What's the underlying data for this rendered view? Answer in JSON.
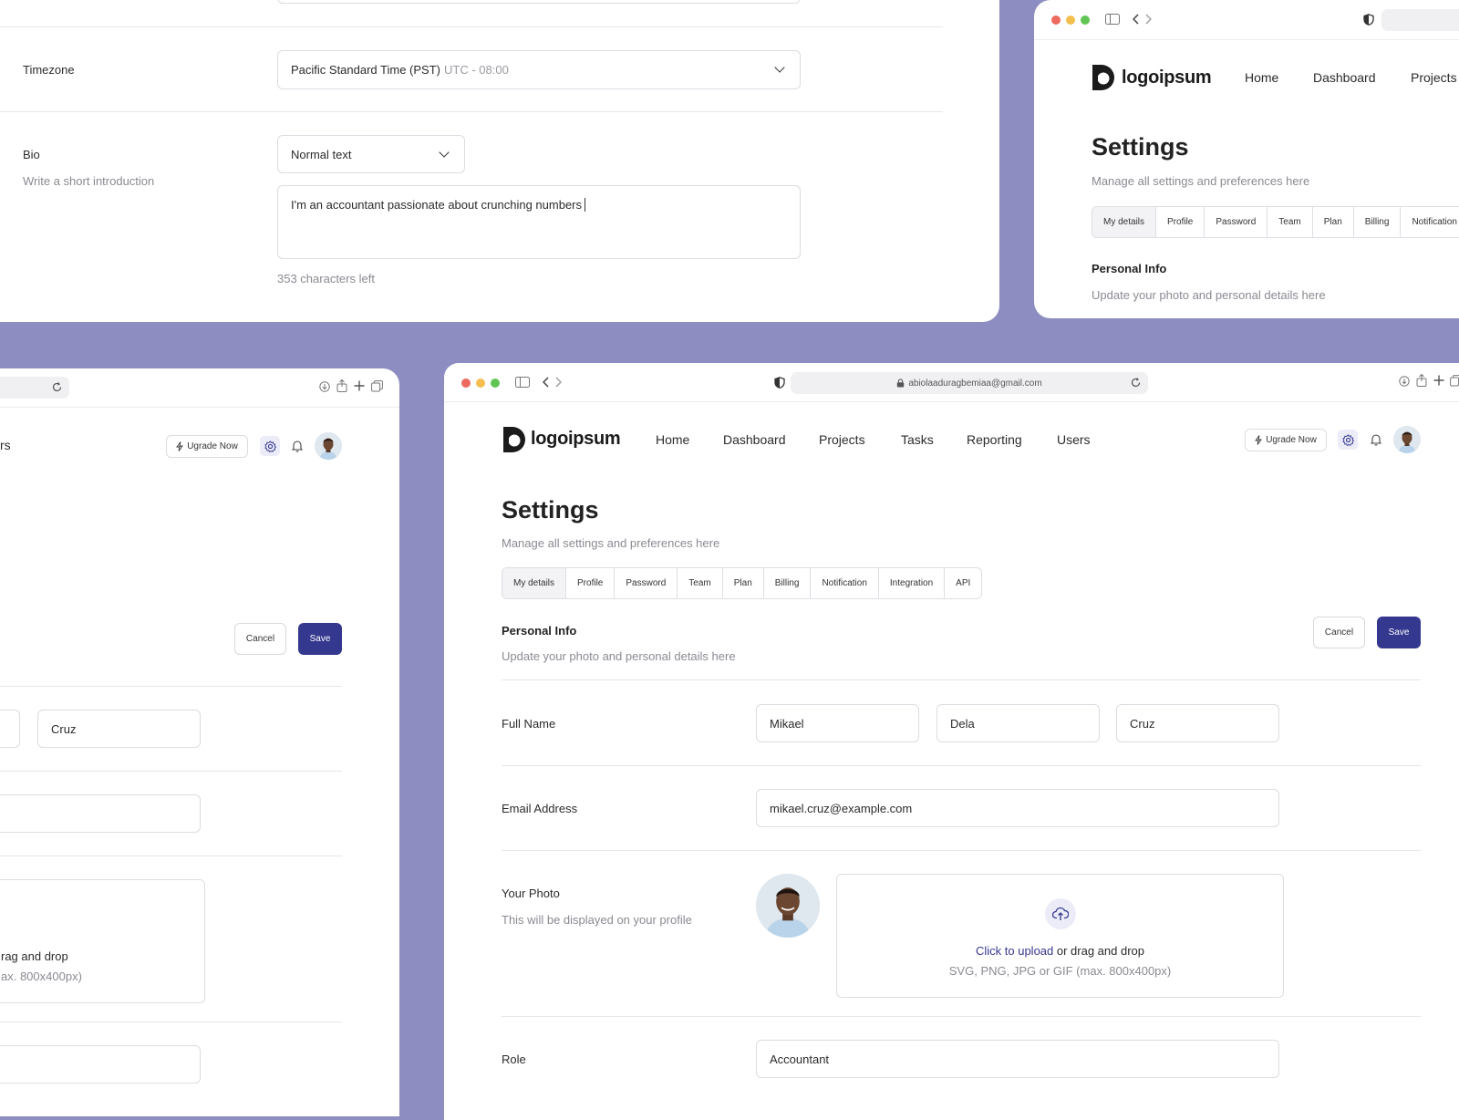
{
  "colors": {
    "background": "#8d8dc1",
    "primary": "#35388f",
    "accent_soft": "#ececf8"
  },
  "top_left": {
    "timezone_label": "Timezone",
    "timezone_value": "Pacific Standard Time (PST)",
    "timezone_offset": "UTC - 08:00",
    "bio_label": "Bio",
    "bio_sub": "Write a short introduction",
    "bio_format": "Normal text",
    "bio_text": "I'm an accountant passionate about crunching numbers",
    "chars_left": "353 characters left"
  },
  "top_right": {
    "logo_text": "logoipsum",
    "nav": [
      "Home",
      "Dashboard",
      "Projects"
    ],
    "title": "Settings",
    "subtitle": "Manage all settings and preferences here",
    "tabs": [
      "My details",
      "Profile",
      "Password",
      "Team",
      "Plan",
      "Billing",
      "Notification"
    ],
    "section_title": "Personal Info",
    "section_sub": "Update your photo and personal details here"
  },
  "bottom_left": {
    "nav_fragment": "rs",
    "upgrade_label": "Ugrade Now",
    "cancel_label": "Cancel",
    "save_label": "Save",
    "last_name": "Cruz",
    "upload_fragment": "rag and drop",
    "hint_fragment": "ax. 800x400px)"
  },
  "main": {
    "address": "abiolaaduragbemiaa@gmail.com",
    "logo_text": "logoipsum",
    "nav": [
      "Home",
      "Dashboard",
      "Projects",
      "Tasks",
      "Reporting",
      "Users"
    ],
    "upgrade_label": "Ugrade Now",
    "title": "Settings",
    "subtitle": "Manage all settings and preferences here",
    "tabs": [
      "My details",
      "Profile",
      "Password",
      "Team",
      "Plan",
      "Billing",
      "Notification",
      "Integration",
      "API"
    ],
    "section_title": "Personal Info",
    "section_sub": "Update your photo and personal details here",
    "cancel_label": "Cancel",
    "save_label": "Save",
    "full_name_label": "Full Name",
    "first_name": "Mikael",
    "middle_name": "Dela",
    "last_name": "Cruz",
    "email_label": "Email Address",
    "email_value": "mikael.cruz@example.com",
    "photo_label": "Your Photo",
    "photo_sub": "This will be displayed on your profile",
    "upload_link": "Click to upload",
    "upload_rest": " or drag and drop",
    "upload_hint": "SVG, PNG, JPG or GIF (max. 800x400px)",
    "role_label": "Role",
    "role_value": "Accountant"
  },
  "icons": [
    "chevron-down-icon",
    "lightning-icon",
    "gear-icon",
    "bell-icon",
    "upload-cloud-icon",
    "lock-icon",
    "reload-icon",
    "shield-icon",
    "sidebar-icon",
    "back-icon",
    "forward-icon",
    "download-icon",
    "share-icon",
    "plus-icon",
    "tabs-icon"
  ]
}
